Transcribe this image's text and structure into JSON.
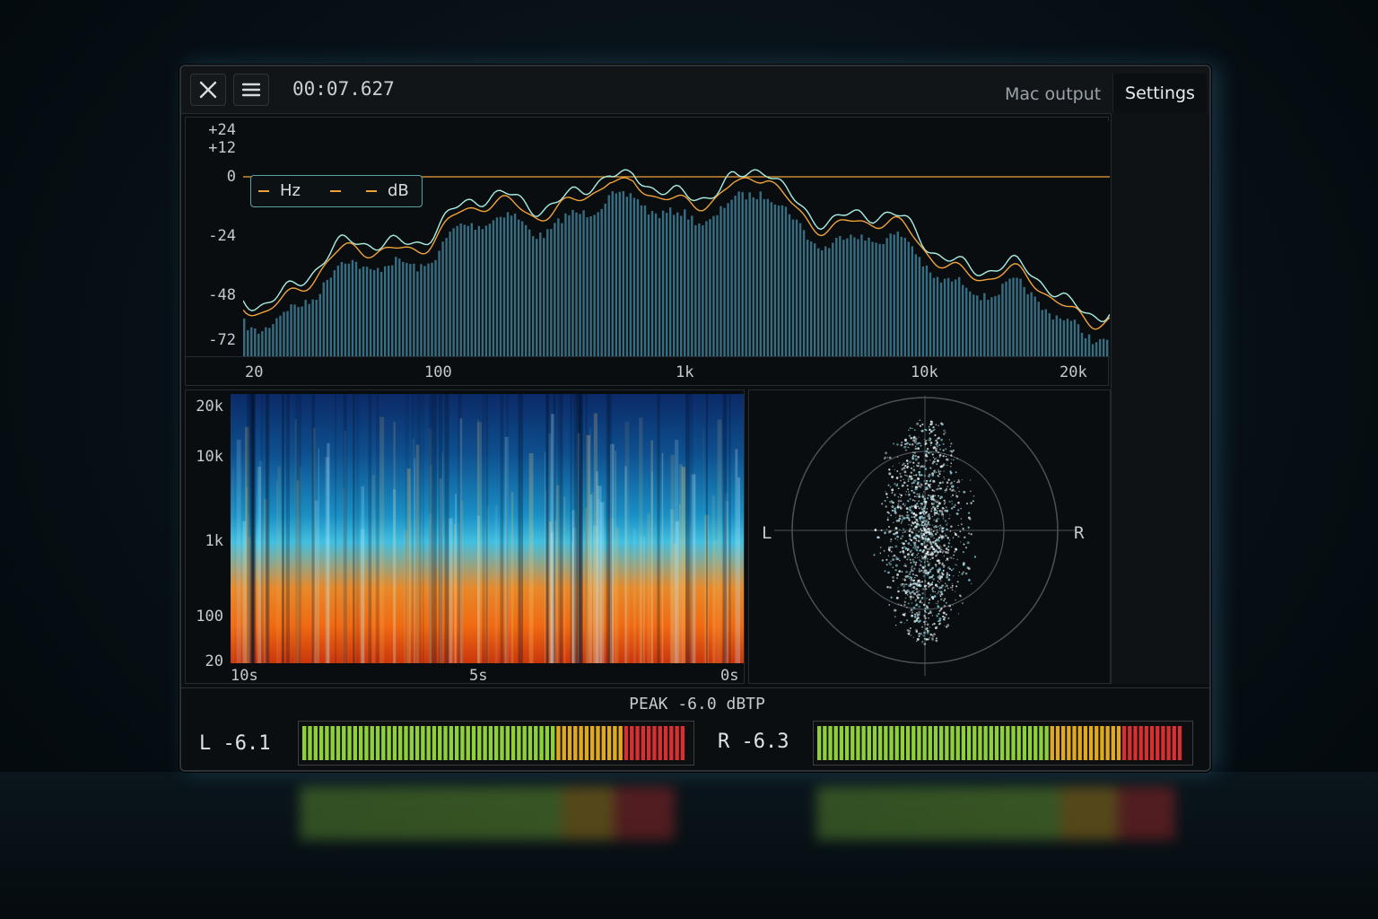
{
  "topbar": {
    "close_icon": "close-icon",
    "menu_icon": "menu-icon",
    "time": "00:07.627",
    "output_device": "Mac output",
    "settings_label": "Settings"
  },
  "spectrum": {
    "legend": {
      "hz": "Hz",
      "db": "dB"
    },
    "y_ticks": [
      "+24",
      "+12",
      "0",
      "-24",
      "-48",
      "-72"
    ],
    "x_ticks": [
      "20",
      "100",
      "1k",
      "10k",
      "20k"
    ]
  },
  "spectrogram": {
    "y_ticks": [
      "20k",
      "10k",
      "1k",
      "100",
      "20"
    ],
    "x_ticks": [
      "10s",
      "5s",
      "0s"
    ]
  },
  "vectorscope": {
    "left_label": "L",
    "right_label": "R"
  },
  "meters": {
    "peak_label": "PEAK  -6.0 dBTP",
    "left": {
      "label": "L -6.1",
      "value_db": -6.1
    },
    "right": {
      "label": "R  -6.3",
      "value_db": -6.3
    }
  },
  "colors": {
    "accent_orange": "#f0a23a",
    "trace_cyan": "#a8efe6",
    "bars": "#3f7f96",
    "meter_green": "#8fcf3a",
    "meter_yellow": "#e1a91e",
    "meter_red": "#d63030"
  }
}
